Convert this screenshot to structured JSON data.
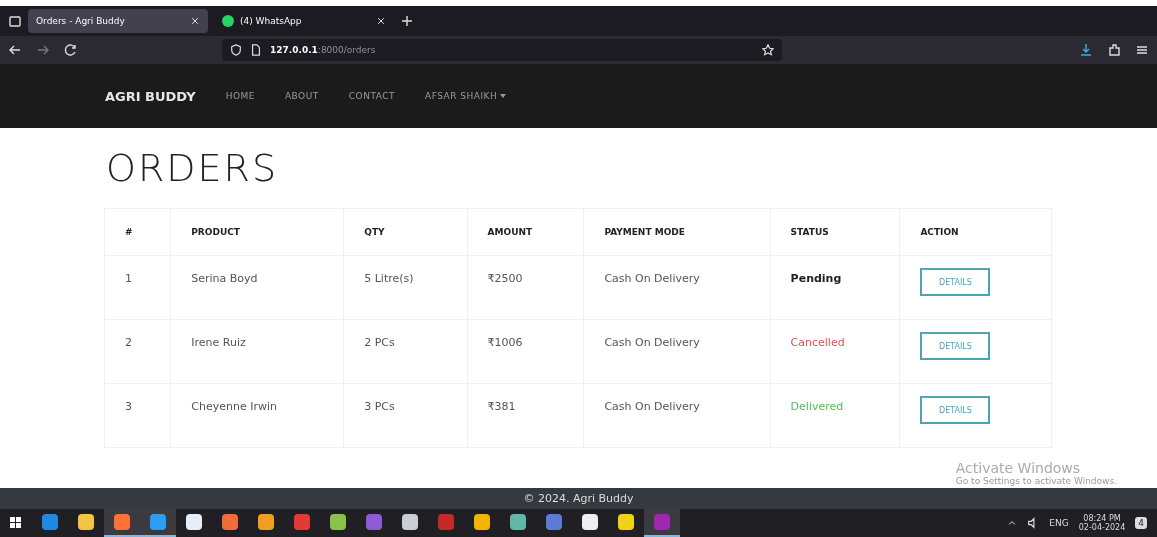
{
  "browser": {
    "tabs": [
      {
        "title": "Orders - Agri Buddy",
        "selected": true,
        "kind": "page"
      },
      {
        "title": "(4) WhatsApp",
        "selected": false,
        "kind": "chat"
      }
    ],
    "address": {
      "host": "127.0.0.1",
      "rest": ":8000/orders"
    }
  },
  "navbar": {
    "brand": "AGRI BUDDY",
    "links": [
      "HOME",
      "ABOUT",
      "CONTACT"
    ],
    "user": "AFSAR SHAIKH"
  },
  "page": {
    "title": "ORDERS",
    "table": {
      "columns": [
        "#",
        "PRODUCT",
        "QTY",
        "AMOUNT",
        "PAYMENT MODE",
        "STATUS",
        "ACTION"
      ],
      "rows": [
        {
          "no": "1",
          "product": "Serina Boyd",
          "qty": "5 Litre(s)",
          "amount": "₹2500",
          "payment": "Cash On Delivery",
          "status": "Pending",
          "color": "#222222",
          "bold": true,
          "action": "DETAILS"
        },
        {
          "no": "2",
          "product": "Irene Ruiz",
          "qty": "2 PCs",
          "amount": "₹1006",
          "payment": "Cash On Delivery",
          "status": "Cancelled",
          "color": "#d9534f",
          "bold": false,
          "action": "DETAILS"
        },
        {
          "no": "3",
          "product": "Cheyenne Irwin",
          "qty": "3 PCs",
          "amount": "₹381",
          "payment": "Cash On Delivery",
          "status": "Delivered",
          "color": "#5cb85c",
          "bold": false,
          "action": "DETAILS"
        }
      ]
    }
  },
  "activation": {
    "title": "Activate Windows",
    "subtitle": "Go to Settings to activate Windows."
  },
  "footer": "© 2024. Agri Buddy",
  "taskbar": {
    "apps": [
      {
        "color": "#1e88e5",
        "running": false
      },
      {
        "color": "#f5c342",
        "running": false
      },
      {
        "color": "#ff7139",
        "running": true
      },
      {
        "color": "#2a9df4",
        "running": true
      },
      {
        "color": "#e8eef7",
        "running": false
      },
      {
        "color": "#f26b3a",
        "running": false
      },
      {
        "color": "#f0a020",
        "running": false
      },
      {
        "color": "#e53935",
        "running": false
      },
      {
        "color": "#8bc34a",
        "running": false
      },
      {
        "color": "#8e5bd6",
        "running": false
      },
      {
        "color": "#c9cdd6",
        "running": false
      },
      {
        "color": "#c62828",
        "running": false
      },
      {
        "color": "#f4b400",
        "running": false
      },
      {
        "color": "#5fb8a8",
        "running": false
      },
      {
        "color": "#5b7bd5",
        "running": false
      },
      {
        "color": "#eeeeee",
        "running": false
      },
      {
        "color": "#f2d219",
        "running": false
      },
      {
        "color": "#9c27b0",
        "running": true
      }
    ],
    "lang": "ENG",
    "time": "08:24 PM",
    "date": "02-04-2024",
    "notifications": "4"
  }
}
